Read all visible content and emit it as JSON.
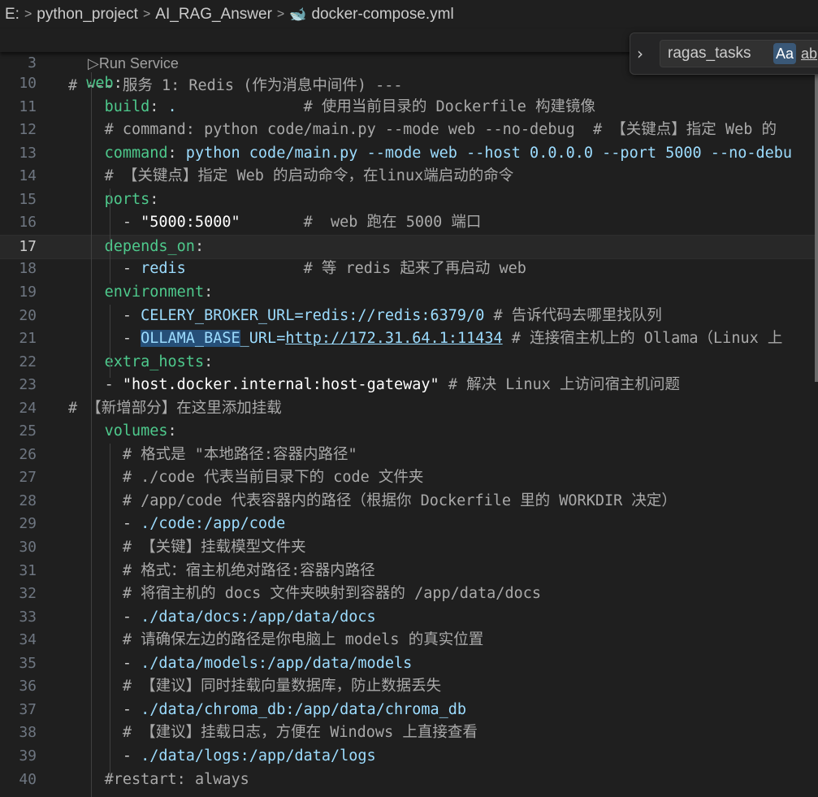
{
  "breadcrumb": {
    "drive": "E:",
    "folder1": "python_project",
    "folder2": "AI_RAG_Answer",
    "file": "docker-compose.yml"
  },
  "sticky": {
    "line_number": "3",
    "text": "# --- 服务 1: Redis (作为消息中间件) ---"
  },
  "codelens": {
    "label": "Run Service"
  },
  "find": {
    "value": "ragas_tasks",
    "match_case_label": "Aa",
    "whole_word_label": "ab"
  },
  "lines": [
    {
      "n": "10",
      "text": "  web:"
    },
    {
      "n": "11",
      "text": "    build: .              # 使用当前目录的 Dockerfile 构建镜像"
    },
    {
      "n": "12",
      "text": "    # command: python code/main.py --mode web --no-debug  # 【关键点】指定 Web 的"
    },
    {
      "n": "13",
      "text": "    command: python code/main.py --mode web --host 0.0.0.0 --port 5000 --no-debu"
    },
    {
      "n": "14",
      "text": "    # 【关键点】指定 Web 的启动命令，在linux端启动的命令"
    },
    {
      "n": "15",
      "text": "    ports:"
    },
    {
      "n": "16",
      "text": "      - \"5000:5000\"       #  web 跑在 5000 端口"
    },
    {
      "n": "17",
      "text": "    depends_on:"
    },
    {
      "n": "18",
      "text": "      - redis             # 等 redis 起来了再启动 web"
    },
    {
      "n": "19",
      "text": "    environment:"
    },
    {
      "n": "20",
      "text": "      - CELERY_BROKER_URL=redis://redis:6379/0 # 告诉代码去哪里找队列"
    },
    {
      "n": "21",
      "text": "      - OLLAMA_BASE_URL=http://172.31.64.1:11434 # 连接宿主机上的 Ollama（Linux 上"
    },
    {
      "n": "22",
      "text": "    extra_hosts:"
    },
    {
      "n": "23",
      "text": "    - \"host.docker.internal:host-gateway\" # 解决 Linux 上访问宿主机问题"
    },
    {
      "n": "24",
      "text": "# 【新增部分】在这里添加挂载"
    },
    {
      "n": "25",
      "text": "    volumes:"
    },
    {
      "n": "26",
      "text": "      # 格式是 \"本地路径:容器内路径\""
    },
    {
      "n": "27",
      "text": "      # ./code 代表当前目录下的 code 文件夹"
    },
    {
      "n": "28",
      "text": "      # /app/code 代表容器内的路径（根据你 Dockerfile 里的 WORKDIR 决定）"
    },
    {
      "n": "29",
      "text": "      - ./code:/app/code"
    },
    {
      "n": "30",
      "text": "      # 【关键】挂载模型文件夹"
    },
    {
      "n": "31",
      "text": "      # 格式：宿主机绝对路径:容器内路径"
    },
    {
      "n": "32",
      "text": "      # 将宿主机的 docs 文件夹映射到容器的 /app/data/docs"
    },
    {
      "n": "33",
      "text": "      - ./data/docs:/app/data/docs"
    },
    {
      "n": "34",
      "text": "      # 请确保左边的路径是你电脑上 models 的真实位置"
    },
    {
      "n": "35",
      "text": "      - ./data/models:/app/data/models"
    },
    {
      "n": "36",
      "text": "      # 【建议】同时挂载向量数据库，防止数据丢失"
    },
    {
      "n": "37",
      "text": "      - ./data/chroma_db:/app/data/chroma_db"
    },
    {
      "n": "38",
      "text": "      # 【建议】挂载日志，方便在 Windows 上直接查看"
    },
    {
      "n": "39",
      "text": "      - ./data/logs:/app/data/logs"
    },
    {
      "n": "40",
      "text": "    #restart: always"
    }
  ],
  "active_line": "17",
  "colors": {
    "background": "#1f1f1f",
    "key": "#4ec98c",
    "comment": "#a9a9a9",
    "string": "#ffffff",
    "value": "#9cdcfe",
    "selection": "#264f78"
  }
}
